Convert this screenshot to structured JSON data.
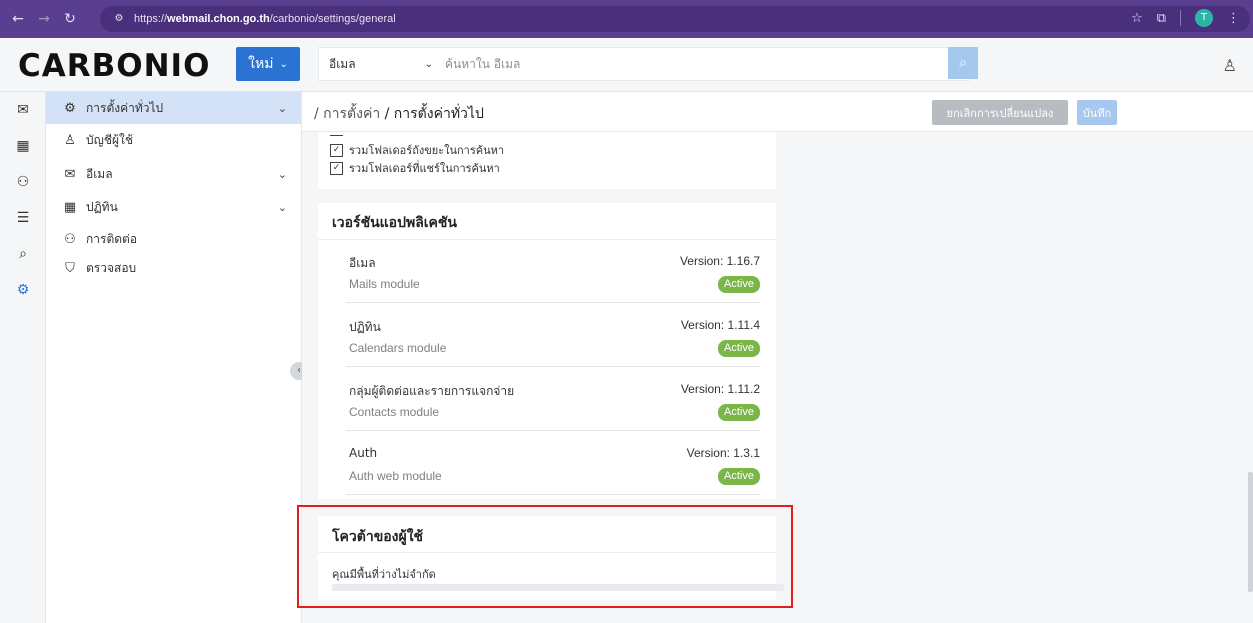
{
  "browser": {
    "url_prefix": "https://",
    "url_host": "webmail.chon.go.th",
    "url_path": "/carbonio/settings/general",
    "profile_initial": "T"
  },
  "header": {
    "logo": "CARBONIO",
    "new_label": "ใหม่",
    "search_module": "อีเมล",
    "search_placeholder": "ค้นหาใน อีเมล"
  },
  "sidebar": {
    "items": [
      {
        "label": "การตั้งค่าทั่วไป",
        "icon": "gear-icon",
        "active": true,
        "expandable": true
      },
      {
        "label": "บัญชีผู้ใช้",
        "icon": "user-icon",
        "active": false,
        "expandable": false
      },
      {
        "label": "อีเมล",
        "icon": "mail-icon",
        "active": false,
        "expandable": true
      },
      {
        "label": "ปฏิทิน",
        "icon": "calendar-icon",
        "active": false,
        "expandable": true
      },
      {
        "label": "การติดต่อ",
        "icon": "contacts-icon",
        "active": false,
        "expandable": false
      },
      {
        "label": "ตรวจสอบ",
        "icon": "shield-icon",
        "active": false,
        "expandable": false
      }
    ]
  },
  "main": {
    "breadcrumb_root": "/ การตั้งค่า",
    "breadcrumb_current": "/ การตั้งค่าทั่วไป",
    "discard_label": "ยกเลิกการเปลี่ยนแปลง",
    "save_label": "บันทึก",
    "search_options": [
      "รวมโฟลเดอร์ถังขยะในการค้นหา",
      "รวมโฟลเดอร์ที่แชร์ในการค้นหา"
    ],
    "versions": {
      "title": "เวอร์ชันแอปพลิเคชัน",
      "modules": [
        {
          "name": "อีเมล",
          "desc": "Mails module",
          "version": "Version: 1.16.7",
          "status": "Active"
        },
        {
          "name": "ปฏิทิน",
          "desc": "Calendars module",
          "version": "Version: 1.11.4",
          "status": "Active"
        },
        {
          "name": "กลุ่มผู้ติดต่อและรายการแจกจ่าย",
          "desc": "Contacts module",
          "version": "Version: 1.11.2",
          "status": "Active"
        },
        {
          "name": "Auth",
          "desc": "Auth web module",
          "version": "Version: 1.3.1",
          "status": "Active"
        }
      ]
    },
    "quota": {
      "title": "โควต้าของผู้ใช้",
      "text": "คุณมีพื้นที่ว่างไม่จำกัด"
    }
  },
  "colors": {
    "browser_bar": "#5a3e8f",
    "accent_blue": "#2b73d2",
    "active_green": "#7ab648",
    "highlight_red": "#e21d1d"
  }
}
